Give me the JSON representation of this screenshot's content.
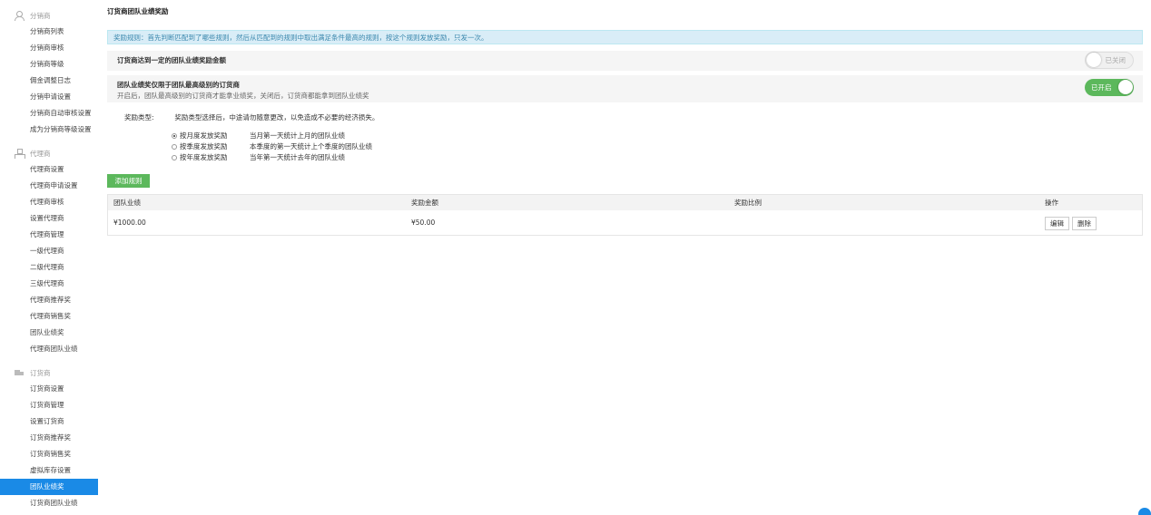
{
  "sidebar": {
    "groups": [
      {
        "title": "分销商",
        "items": [
          "分销商列表",
          "分销商审核",
          "分销商等级",
          "佣金调整日志",
          "分销申请设置",
          "分销商自动审核设置",
          "成为分销商等级设置"
        ]
      },
      {
        "title": "代理商",
        "items": [
          "代理商设置",
          "代理商申请设置",
          "代理商审核",
          "设置代理商",
          "代理商管理",
          "一级代理商",
          "二级代理商",
          "三级代理商",
          "代理商推荐奖",
          "代理商销售奖",
          "团队业绩奖",
          "代理商团队业绩"
        ]
      },
      {
        "title": "订货商",
        "items": [
          "订货商设置",
          "订货商管理",
          "设置订货商",
          "订货商推荐奖",
          "订货商销售奖",
          "虚拟库存设置",
          "团队业绩奖",
          "订货商团队业绩"
        ]
      }
    ],
    "active_item": "团队业绩奖"
  },
  "page": {
    "title": "订货商团队业绩奖励",
    "notice": "奖励规则：首先判断匹配到了哪些规则，然后从匹配到的规则中取出满足条件最高的规则，按这个规则发放奖励，只发一次。"
  },
  "settings": {
    "threshold": {
      "title": "订货商达到一定的团队业绩奖励金额",
      "switch_label": "已关闭",
      "enabled": false
    },
    "highest_only": {
      "title": "团队业绩奖仅限于团队最高级别的订货商",
      "desc": "开启后，团队最高级别的订货商才能拿业绩奖，关闭后，订货商都能拿到团队业绩奖",
      "switch_label": "已开启",
      "enabled": true
    }
  },
  "reward_type": {
    "label": "奖励类型:",
    "note": "奖励类型选择后，中途请勿随意更改，以免造成不必要的经济损失。",
    "options": [
      {
        "label": "按月度发放奖励",
        "desc": "当月第一天统计上月的团队业绩",
        "checked": true
      },
      {
        "label": "按季度发放奖励",
        "desc": "本季度的第一天统计上个季度的团队业绩",
        "checked": false
      },
      {
        "label": "按年度发放奖励",
        "desc": "当年第一天统计去年的团队业绩",
        "checked": false
      }
    ]
  },
  "add_rule_label": "添加规则",
  "table": {
    "headers": [
      "团队业绩",
      "奖励金额",
      "奖励比例",
      "操作"
    ],
    "rows": [
      {
        "performance": "¥1000.00",
        "reward": "¥50.00",
        "ratio": "",
        "edit_label": "编辑",
        "delete_label": "删除"
      }
    ]
  },
  "colors": {
    "accent": "#1a8ae6",
    "success": "#5cb85c",
    "notice_bg": "#d9edf7",
    "notice_text": "#3a87ad"
  }
}
